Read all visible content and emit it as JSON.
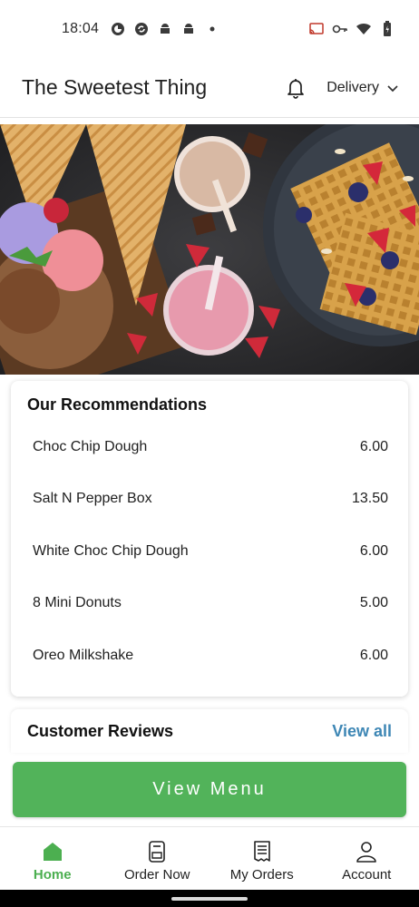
{
  "status_bar": {
    "time": "18:04"
  },
  "header": {
    "title": "The Sweetest Thing",
    "delivery_label": "Delivery"
  },
  "recommendations": {
    "title": "Our Recommendations",
    "items": [
      {
        "name": "Choc Chip Dough",
        "price": "6.00"
      },
      {
        "name": "Salt N Pepper Box",
        "price": "13.50"
      },
      {
        "name": "White Choc Chip Dough",
        "price": "6.00"
      },
      {
        "name": "8 Mini Donuts",
        "price": "5.00"
      },
      {
        "name": "Oreo Milkshake",
        "price": "6.00"
      }
    ]
  },
  "reviews": {
    "title": "Customer Reviews",
    "view_all_label": "View all"
  },
  "view_menu_label": "View Menu",
  "bottom_nav": {
    "items": [
      {
        "label": "Home",
        "icon": "home-icon",
        "active": true
      },
      {
        "label": "Order Now",
        "icon": "order-icon",
        "active": false
      },
      {
        "label": "My Orders",
        "icon": "receipt-icon",
        "active": false
      },
      {
        "label": "Account",
        "icon": "account-icon",
        "active": false
      }
    ]
  },
  "colors": {
    "accent_green": "#52b35a",
    "link_blue": "#3e87b5"
  }
}
